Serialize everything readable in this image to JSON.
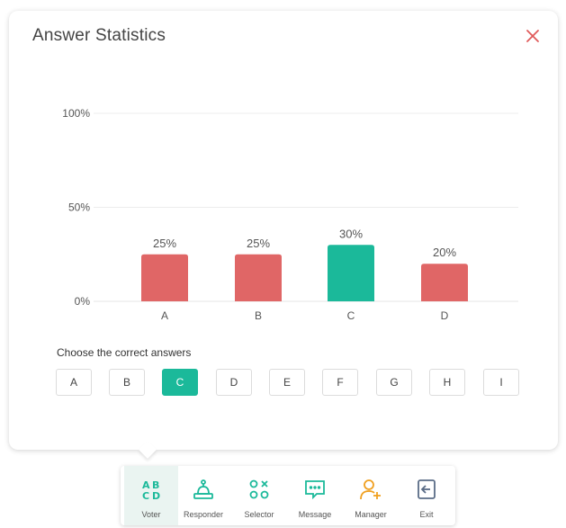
{
  "dialog": {
    "title": "Answer Statistics",
    "close_icon": "close-icon",
    "prompt": "Choose the correct answers",
    "choices": [
      {
        "label": "A",
        "selected": false
      },
      {
        "label": "B",
        "selected": false
      },
      {
        "label": "C",
        "selected": true
      },
      {
        "label": "D",
        "selected": false
      },
      {
        "label": "E",
        "selected": false
      },
      {
        "label": "F",
        "selected": false
      },
      {
        "label": "G",
        "selected": false
      },
      {
        "label": "H",
        "selected": false
      },
      {
        "label": "I",
        "selected": false
      }
    ]
  },
  "colors": {
    "accent": "#1bb99a",
    "incorrect": "#e06666",
    "close": "#e05a5a"
  },
  "chart_data": {
    "type": "bar",
    "categories": [
      "A",
      "B",
      "C",
      "D"
    ],
    "values": [
      25,
      25,
      30,
      20
    ],
    "value_labels": [
      "25%",
      "25%",
      "30%",
      "20%"
    ],
    "y_ticks": [
      0,
      50,
      100
    ],
    "y_tick_labels": [
      "0%",
      "50%",
      "100%"
    ],
    "ylim": [
      0,
      100
    ],
    "grid": true,
    "correct_category": "C",
    "title": "",
    "xlabel": "",
    "ylabel": ""
  },
  "toolbar": {
    "items": [
      {
        "label": "Voter",
        "icon": "abcd-icon",
        "active": true
      },
      {
        "label": "Responder",
        "icon": "buzzer-icon",
        "active": false
      },
      {
        "label": "Selector",
        "icon": "selector-icon",
        "active": false
      },
      {
        "label": "Message",
        "icon": "message-icon",
        "active": false
      },
      {
        "label": "Manager",
        "icon": "user-add-icon",
        "active": false
      },
      {
        "label": "Exit",
        "icon": "exit-icon",
        "active": false
      }
    ]
  }
}
